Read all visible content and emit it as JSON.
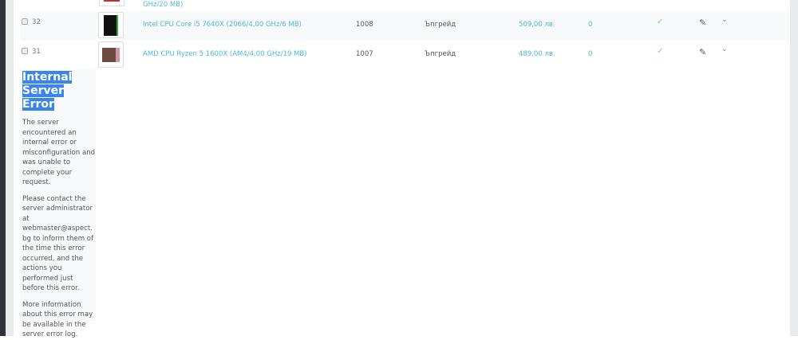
{
  "top_fragment": "GHz/20 MB)",
  "rows": [
    {
      "id": "32",
      "name": "Intel CPU Core i5 7640X (2066/4.00 GHz/6 MB)",
      "code": "1008",
      "category": "Ъпгрейд",
      "price": "509,00 лв.",
      "qty": "0"
    },
    {
      "id": "31",
      "name": "AMD CPU Ryzen 5 1600X (AM4/4.00 GHz/19 MB)",
      "code": "1007",
      "category": "Ъпгрейд",
      "price": "489,00 лв.",
      "qty": "0"
    }
  ],
  "icons": {
    "check": "✓",
    "edit": "✎",
    "chevron": "⌄"
  },
  "error": {
    "title_line1": "Internal",
    "title_line2": "Server Error",
    "p1": "The server encountered an internal error or misconfiguration and was unable to complete your request.",
    "p2": "Please contact the server administrator at webmaster@aspect.bg to inform them of the time this error occurred, and the actions you performed just before this error.",
    "p3": "More information about this error may be available in the server error log."
  }
}
